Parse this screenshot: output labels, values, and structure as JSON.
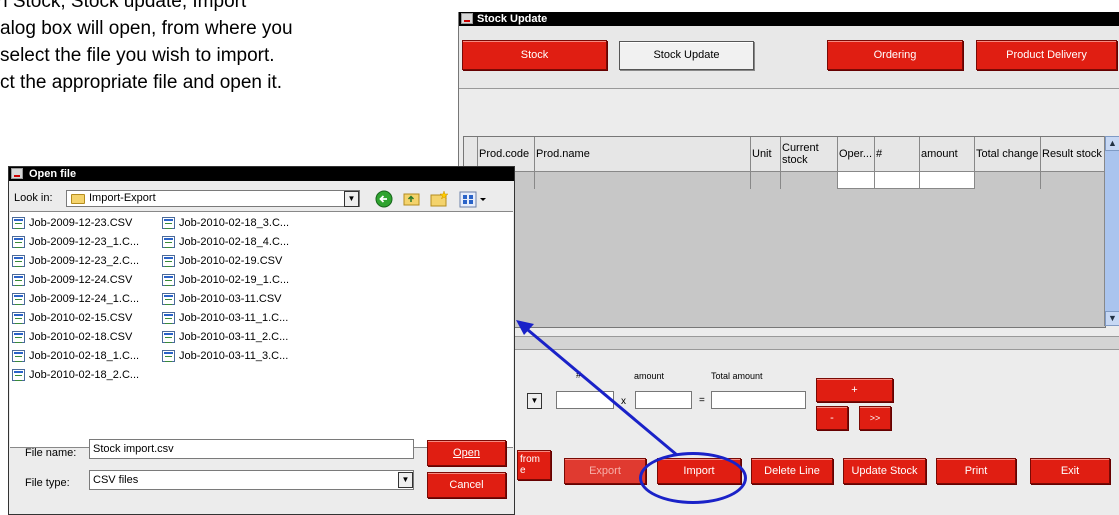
{
  "instructions": {
    "lines": [
      "n Stock, Stock update, Import",
      "alog box will open, from where you",
      "select the file you wish to import.",
      "ct the appropriate file and open it."
    ]
  },
  "stock_window": {
    "title": "Stock Update",
    "buttons": {
      "stock": "Stock",
      "stock_update": "Stock Update",
      "ordering": "Ordering",
      "product_delivery": "Product Delivery"
    },
    "columns": [
      "Prod.code",
      "Prod.name",
      "Unit",
      "Current stock",
      "Oper...",
      "#",
      "amount",
      "Total change",
      "Result stock"
    ],
    "form": {
      "hash_label": "#",
      "amount_label": "amount",
      "total_amount_label": "Total amount",
      "x_sign": "x",
      "eq_sign": "=",
      "plus_btn": "+",
      "minus_btn": "-",
      "next_btn": ">>"
    },
    "bottom_buttons": {
      "from": "from\ne",
      "export": "Export",
      "import": "Import",
      "delete_line": "Delete Line",
      "update_stock": "Update Stock",
      "print": "Print",
      "exit": "Exit"
    }
  },
  "open_dialog": {
    "title": "Open file",
    "look_in_label": "Look in:",
    "look_in_value": "Import-Export",
    "files_col1": [
      "Job-2009-12-23.CSV",
      "Job-2009-12-23_1.C...",
      "Job-2009-12-23_2.C...",
      "Job-2009-12-24.CSV",
      "Job-2009-12-24_1.C...",
      "Job-2010-02-15.CSV",
      "Job-2010-02-18.CSV",
      "Job-2010-02-18_1.C...",
      "Job-2010-02-18_2.C..."
    ],
    "files_col2": [
      "Job-2010-02-18_3.C...",
      "Job-2010-02-18_4.C...",
      "Job-2010-02-19.CSV",
      "Job-2010-02-19_1.C...",
      "Job-2010-03-11.CSV",
      "Job-2010-03-11_1.C...",
      "Job-2010-03-11_2.C...",
      "Job-2010-03-11_3.C..."
    ],
    "file_name_label": "File name:",
    "file_name_value": "Stock import.csv",
    "file_type_label": "File type:",
    "file_type_value": "CSV files",
    "open_btn": "Open",
    "cancel_btn": "Cancel"
  },
  "colors": {
    "button_red": "#e01e12",
    "annotation_blue": "#1a22c8",
    "title_bar": "#000000"
  }
}
